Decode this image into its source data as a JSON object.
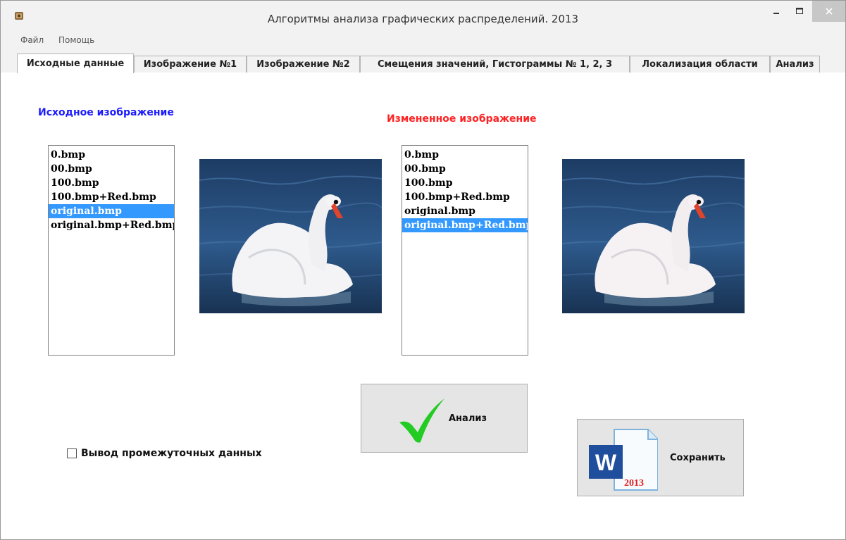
{
  "window": {
    "title": "Алгоритмы анализа графических распределений.    2013"
  },
  "menu": {
    "items": [
      "Файл",
      "Помощь"
    ]
  },
  "tabs": [
    {
      "label": "Исходные данные",
      "active": true
    },
    {
      "label": "Изображение №1",
      "active": false
    },
    {
      "label": "Изображение №2",
      "active": false
    },
    {
      "label": "Смещения значений, Гистограммы № 1, 2, 3",
      "active": false
    },
    {
      "label": "Локализация области",
      "active": false
    },
    {
      "label": "Анализ",
      "active": false
    }
  ],
  "source": {
    "heading": "Исходное изображение",
    "files": [
      "0.bmp",
      "00.bmp",
      "100.bmp",
      "100.bmp+Red.bmp",
      "original.bmp",
      "original.bmp+Red.bmp"
    ],
    "selected_index": 4
  },
  "modified": {
    "heading": "Измененное изображение",
    "files": [
      "0.bmp",
      "00.bmp",
      "100.bmp",
      "100.bmp+Red.bmp",
      "original.bmp",
      "original.bmp+Red.bmp"
    ],
    "selected_index": 5
  },
  "buttons": {
    "analyze": "Анализ",
    "save": "Сохранить",
    "word_year": "2013"
  },
  "checkbox": {
    "label": "Вывод промежуточных данных",
    "checked": false
  },
  "colors": {
    "selection": "#3399ff",
    "source_heading": "#1a1aff",
    "modified_heading": "#ff2222",
    "check_icon": "#22cc22",
    "word_blue": "#1f4e9c"
  }
}
